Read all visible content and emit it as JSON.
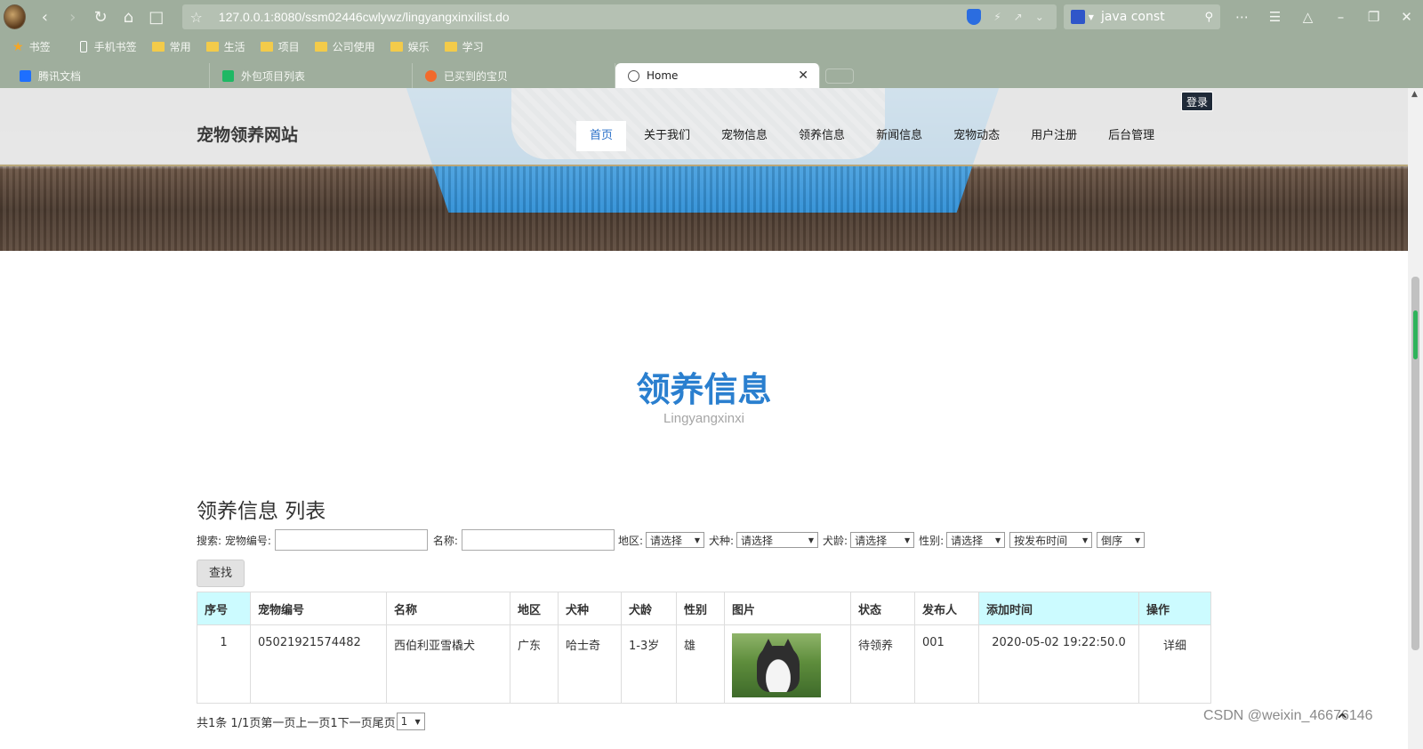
{
  "browser": {
    "url": "127.0.0.1:8080/ssm02446cwlywz/lingyangxinxilist.do",
    "search_text": "java const",
    "bookmarks": [
      "书签",
      "手机书签",
      "常用",
      "生活",
      "项目",
      "公司使用",
      "娱乐",
      "学习"
    ],
    "tabs": [
      {
        "label": "腾讯文档"
      },
      {
        "label": "外包项目列表"
      },
      {
        "label": "已买到的宝贝"
      },
      {
        "label": "Home",
        "active": true
      }
    ]
  },
  "site": {
    "title": "宠物领养网站",
    "login": "登录",
    "menu": [
      "首页",
      "关于我们",
      "宠物信息",
      "领养信息",
      "新闻信息",
      "宠物动态",
      "用户注册",
      "后台管理"
    ],
    "active_menu": "首页"
  },
  "section": {
    "title": "领养信息",
    "subtitle": "Lingyangxinxi"
  },
  "list": {
    "title": "领养信息 列表",
    "search_label": "搜索: 宠物编号:",
    "name_label": "名称:",
    "region_label": "地区:",
    "breed_label": "犬种:",
    "age_label": "犬龄:",
    "gender_label": "性别:",
    "placeholder_select": "请选择",
    "sort_by": "按发布时间",
    "sort_order": "倒序",
    "find_button": "查找",
    "columns": [
      "序号",
      "宠物编号",
      "名称",
      "地区",
      "犬种",
      "犬龄",
      "性别",
      "图片",
      "状态",
      "发布人",
      "添加时间",
      "操作"
    ],
    "rows": [
      {
        "index": "1",
        "pet_id": "05021921574482",
        "name": "西伯利亚雪橇犬",
        "region": "广东",
        "breed": "哈士奇",
        "age": "1-3岁",
        "gender": "雄",
        "status": "待领养",
        "publisher": "001",
        "added": "2020-05-02 19:22:50.0",
        "action": "详细"
      }
    ],
    "pager_text": "共1条 1/1页第一页上一页1下一页尾页",
    "page_select": "1"
  },
  "watermark": "CSDN @weixin_46676146"
}
